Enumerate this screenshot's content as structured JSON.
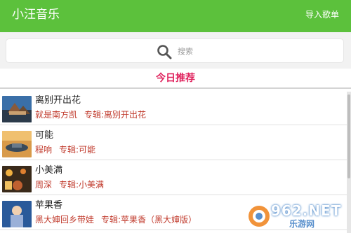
{
  "header": {
    "title": "小汪音乐",
    "import_label": "导入歌单"
  },
  "search": {
    "placeholder": "搜索"
  },
  "section": {
    "title": "今日推荐"
  },
  "songs": [
    {
      "title": "离别开出花",
      "artist": "就是南方凯",
      "album": "专辑:离别开出花"
    },
    {
      "title": "可能",
      "artist": "程响",
      "album": "专辑:可能"
    },
    {
      "title": "小美满",
      "artist": "周深",
      "album": "专辑:小美满"
    },
    {
      "title": "苹果香",
      "artist": "黑大婶回乡带娃",
      "album": "专辑:苹果香（黑大婶版）"
    }
  ],
  "watermark": {
    "number": "962.NET",
    "text": "乐游网"
  },
  "colors": {
    "header": "#5cc13c",
    "accent": "#e0245e",
    "meta": "#c0392b"
  },
  "icons": {
    "search": "search-icon"
  }
}
